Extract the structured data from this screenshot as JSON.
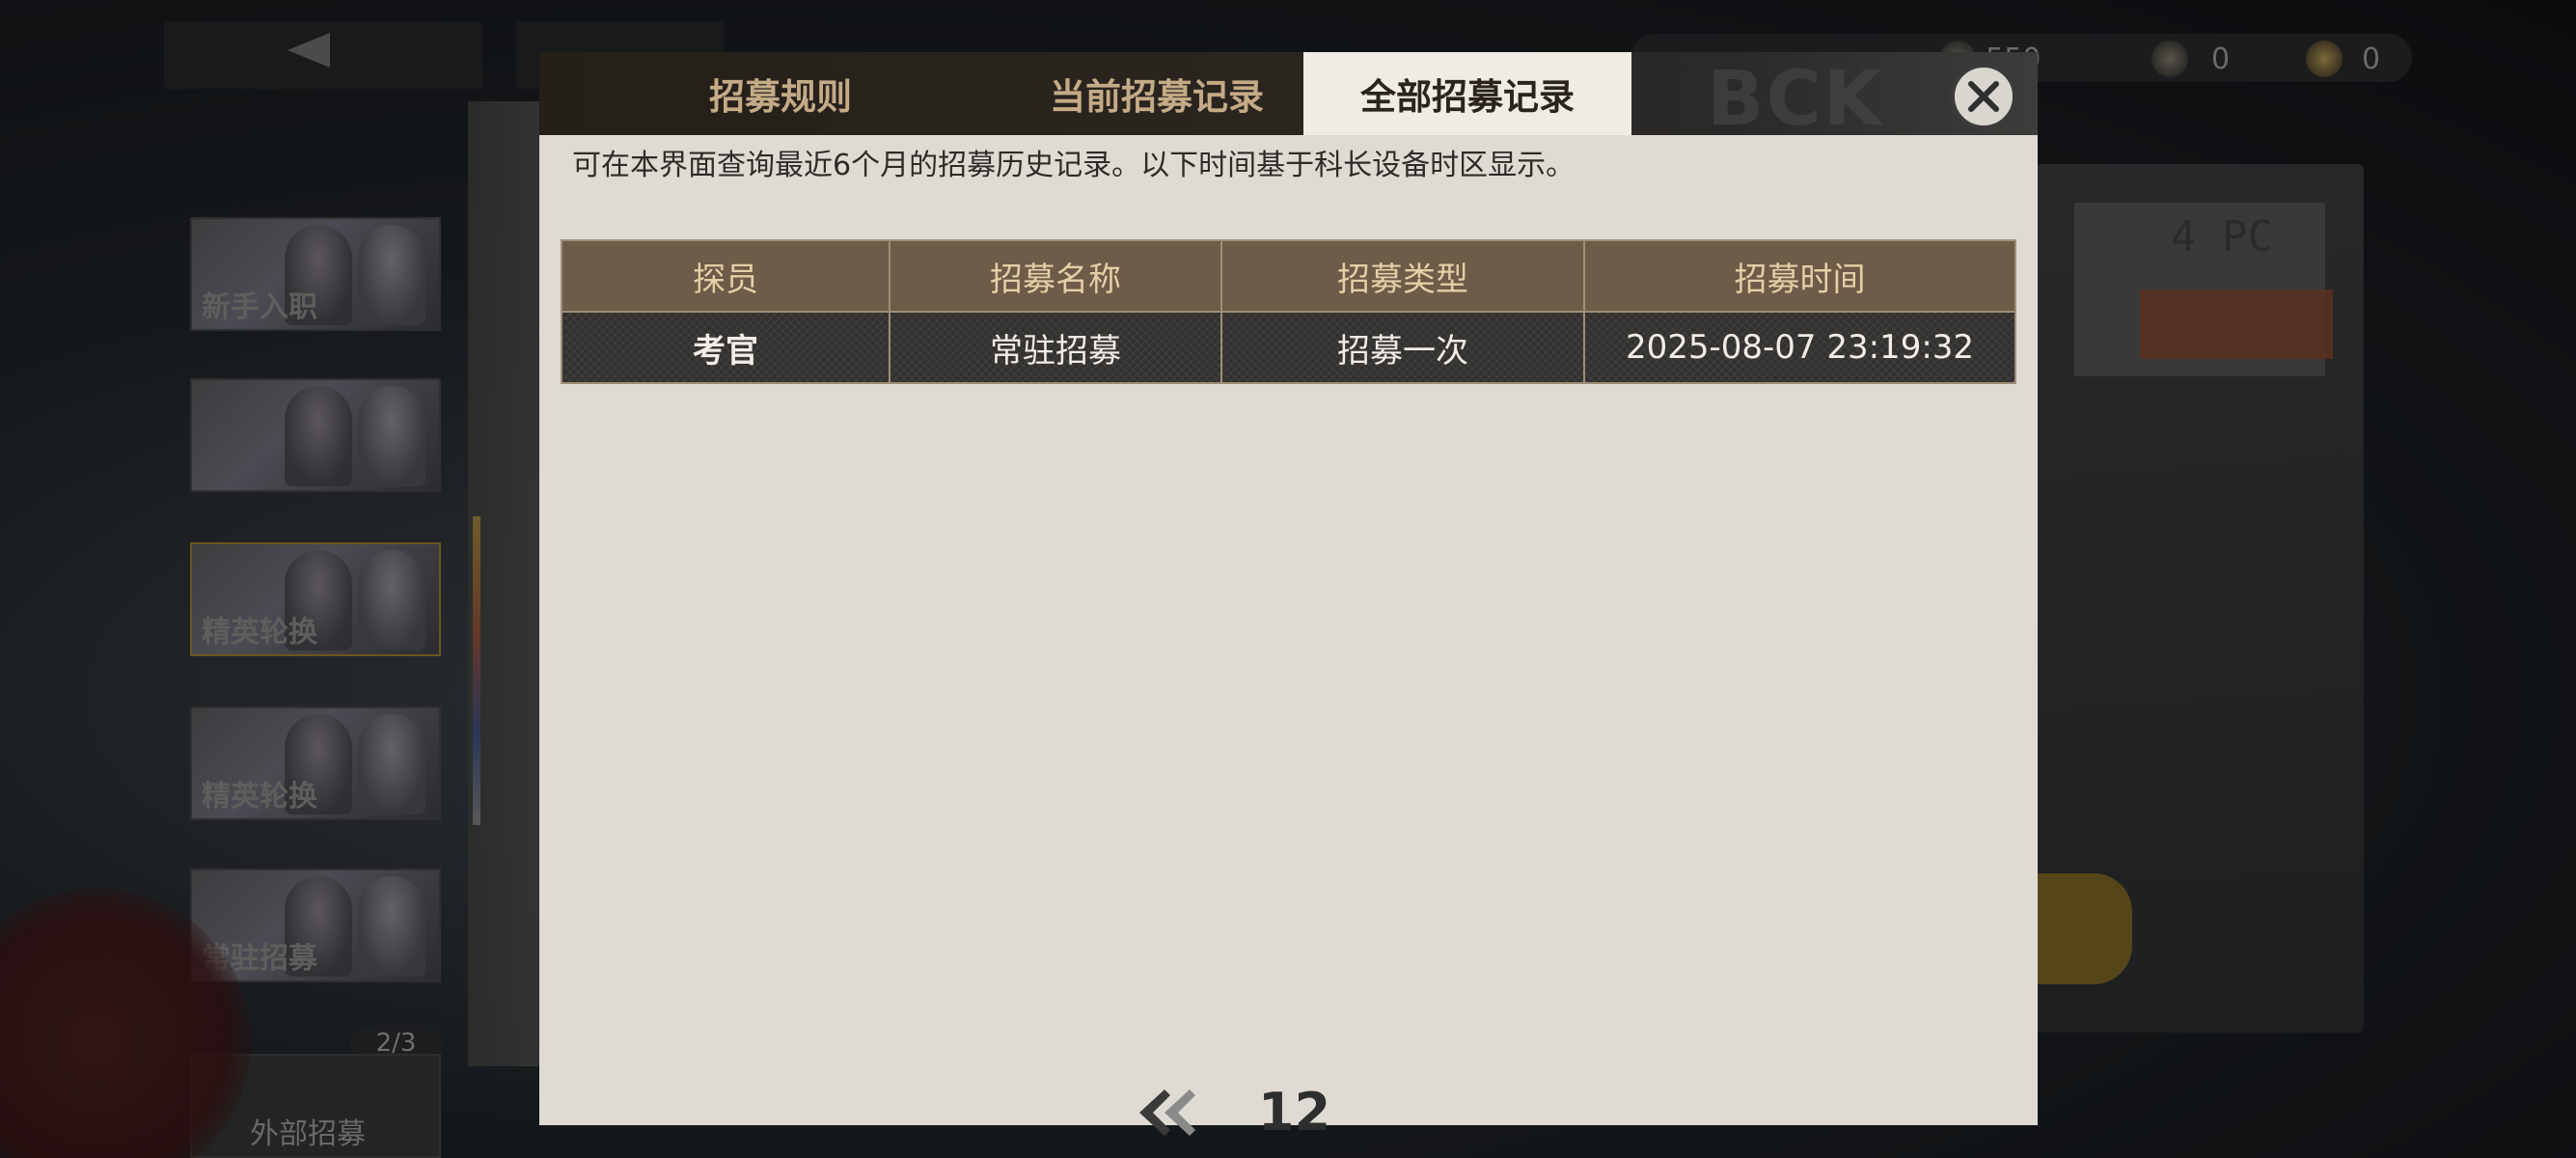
{
  "background": {
    "currency": [
      {
        "icon": "coin-icon",
        "value": "550"
      },
      {
        "icon": "gear-coin-icon",
        "value": "0"
      },
      {
        "icon": "gold-coin-icon",
        "value": "0"
      }
    ],
    "banners": [
      {
        "label": "新手入职"
      },
      {
        "label": ""
      },
      {
        "label": "精英轮换"
      },
      {
        "label": "精英轮换"
      },
      {
        "label": "常驻招募"
      }
    ],
    "page_count": "2/3",
    "external_label": "外部招募",
    "right_panel_text": "4 PC"
  },
  "modal": {
    "tabs": [
      {
        "label": "招募规则",
        "active": false
      },
      {
        "label": "当前招募记录",
        "active": false
      },
      {
        "label": "全部招募记录",
        "active": true
      }
    ],
    "notice": "可在本界面查询最近6个月的招募历史记录。以下时间基于科长设备时区显示。",
    "table": {
      "headers": [
        "探员",
        "招募名称",
        "招募类型",
        "招募时间"
      ],
      "rows": [
        [
          "考官",
          "常驻招募",
          "招募一次",
          "2025-08-07 23:19:32"
        ]
      ]
    },
    "pager": {
      "prev_icon": "double-chevron-left-icon",
      "page_label": "12"
    }
  },
  "colors": {
    "tab_bar": "#241f19",
    "tab_text": "#c4ab86",
    "active_tab_bg": "#efebe5",
    "body_bg": "#dfdad4",
    "header_bg": "#6c5c48",
    "header_text": "#e4cfa6",
    "row_bg": "#333130"
  }
}
